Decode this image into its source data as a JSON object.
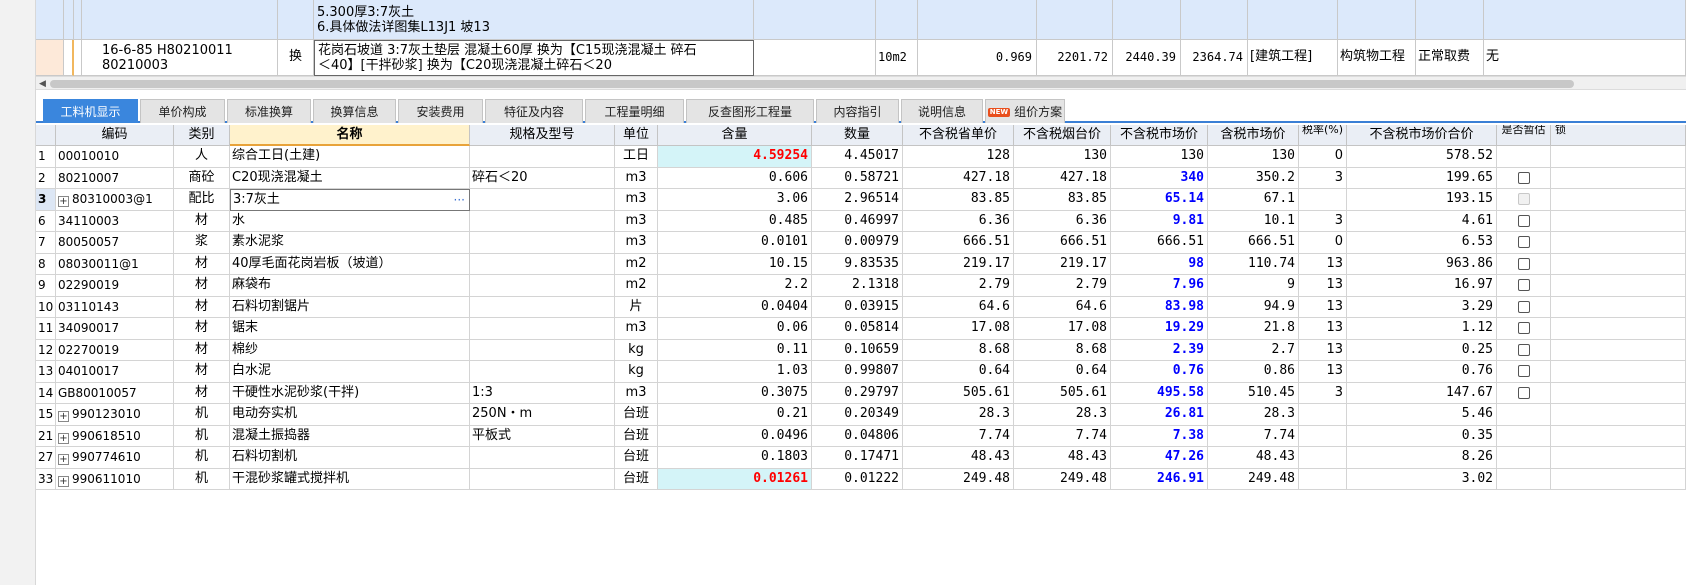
{
  "upper": {
    "row1": {
      "desc_lines": [
        "5.300厚3:7灰土",
        "6.具体做法详图集L13J1 坡13"
      ]
    },
    "row2": {
      "code_line1": "16-6-85 H80210011",
      "code_line2": "80210003",
      "type": "换",
      "desc_line1": "花岗石坡道 3:7灰土垫层 混凝土60厚  换为【C15现浇混凝土 碎石",
      "desc_line2": "＜40】[干拌砂浆]  换为【C20现浇混凝土碎石＜20",
      "unit": "10m2",
      "qty": "0.969",
      "price1": "2201.72",
      "price2": "2440.39",
      "price3": "2364.74",
      "category": "[建筑工程]",
      "project": "构筑物工程",
      "fee": "正常取费",
      "flag": "无"
    }
  },
  "tabs": [
    {
      "label": "工料机显示",
      "active": true
    },
    {
      "label": "单价构成"
    },
    {
      "label": "标准换算"
    },
    {
      "label": "换算信息"
    },
    {
      "label": "安装费用"
    },
    {
      "label": "特征及内容"
    },
    {
      "label": "工程量明细"
    },
    {
      "label": "反查图形工程量"
    },
    {
      "label": "内容指引"
    },
    {
      "label": "说明信息"
    },
    {
      "label": "组价方案",
      "badge": "NEW"
    }
  ],
  "columns": [
    "",
    "编码",
    "类别",
    "名称",
    "规格及型号",
    "单位",
    "含量",
    "数量",
    "不含税省单价",
    "不含税烟台价",
    "不含税市场价",
    "含税市场价",
    "税率(%)",
    "不含税市场价合价",
    "是否暂估",
    "锁"
  ],
  "rows": [
    {
      "n": "1",
      "code": "00010010",
      "type": "人",
      "name": "综合工日(土建)",
      "spec": "",
      "unit": "工日",
      "content": "4.59254",
      "qty": "4.45017",
      "p1": "128",
      "p2": "130",
      "p3": "130",
      "p4": "130",
      "tax": "0",
      "total": "578.52",
      "chk": false,
      "content_style": "red",
      "p3_style": "normal"
    },
    {
      "n": "2",
      "code": "80210007",
      "type": "商砼",
      "name": "C20现浇混凝土",
      "spec": "碎石＜20",
      "unit": "m3",
      "content": "0.606",
      "qty": "0.58721",
      "p1": "427.18",
      "p2": "427.18",
      "p3": "340",
      "p4": "350.2",
      "tax": "3",
      "total": "199.65",
      "chk": true,
      "p3_style": "blue"
    },
    {
      "n": "3",
      "code": "80310003@1",
      "type": "配比",
      "name": "3:7灰土",
      "spec": "",
      "unit": "m3",
      "content": "3.06",
      "qty": "2.96514",
      "p1": "83.85",
      "p2": "83.85",
      "p3": "65.14",
      "p4": "67.1",
      "tax": "",
      "total": "193.15",
      "chk": "disabled",
      "p3_style": "blue",
      "expand": true,
      "selected": true
    },
    {
      "n": "6",
      "code": "34110003",
      "type": "材",
      "name": "水",
      "spec": "",
      "unit": "m3",
      "content": "0.485",
      "qty": "0.46997",
      "p1": "6.36",
      "p2": "6.36",
      "p3": "9.81",
      "p4": "10.1",
      "tax": "3",
      "total": "4.61",
      "chk": true,
      "p3_style": "blue"
    },
    {
      "n": "7",
      "code": "80050057",
      "type": "浆",
      "name": "素水泥浆",
      "spec": "",
      "unit": "m3",
      "content": "0.0101",
      "qty": "0.00979",
      "p1": "666.51",
      "p2": "666.51",
      "p3": "666.51",
      "p4": "666.51",
      "tax": "0",
      "total": "6.53",
      "chk": true,
      "p3_style": "normal"
    },
    {
      "n": "8",
      "code": "08030011@1",
      "type": "材",
      "name": "40厚毛面花岗岩板（坡道）",
      "spec": "",
      "unit": "m2",
      "content": "10.15",
      "qty": "9.83535",
      "p1": "219.17",
      "p2": "219.17",
      "p3": "98",
      "p4": "110.74",
      "tax": "13",
      "total": "963.86",
      "chk": true,
      "p3_style": "blue"
    },
    {
      "n": "9",
      "code": "02290019",
      "type": "材",
      "name": "麻袋布",
      "spec": "",
      "unit": "m2",
      "content": "2.2",
      "qty": "2.1318",
      "p1": "2.79",
      "p2": "2.79",
      "p3": "7.96",
      "p4": "9",
      "tax": "13",
      "total": "16.97",
      "chk": true,
      "p3_style": "blue"
    },
    {
      "n": "10",
      "code": "03110143",
      "type": "材",
      "name": "石料切割锯片",
      "spec": "",
      "unit": "片",
      "content": "0.0404",
      "qty": "0.03915",
      "p1": "64.6",
      "p2": "64.6",
      "p3": "83.98",
      "p4": "94.9",
      "tax": "13",
      "total": "3.29",
      "chk": true,
      "p3_style": "blue"
    },
    {
      "n": "11",
      "code": "34090017",
      "type": "材",
      "name": "锯末",
      "spec": "",
      "unit": "m3",
      "content": "0.06",
      "qty": "0.05814",
      "p1": "17.08",
      "p2": "17.08",
      "p3": "19.29",
      "p4": "21.8",
      "tax": "13",
      "total": "1.12",
      "chk": true,
      "p3_style": "blue"
    },
    {
      "n": "12",
      "code": "02270019",
      "type": "材",
      "name": "棉纱",
      "spec": "",
      "unit": "kg",
      "content": "0.11",
      "qty": "0.10659",
      "p1": "8.68",
      "p2": "8.68",
      "p3": "2.39",
      "p4": "2.7",
      "tax": "13",
      "total": "0.25",
      "chk": true,
      "p3_style": "blue"
    },
    {
      "n": "13",
      "code": "04010017",
      "type": "材",
      "name": "白水泥",
      "spec": "",
      "unit": "kg",
      "content": "1.03",
      "qty": "0.99807",
      "p1": "0.64",
      "p2": "0.64",
      "p3": "0.76",
      "p4": "0.86",
      "tax": "13",
      "total": "0.76",
      "chk": true,
      "p3_style": "blue"
    },
    {
      "n": "14",
      "code": "GB80010057",
      "type": "材",
      "name": "干硬性水泥砂浆(干拌)",
      "spec": "1:3",
      "unit": "m3",
      "content": "0.3075",
      "qty": "0.29797",
      "p1": "505.61",
      "p2": "505.61",
      "p3": "495.58",
      "p4": "510.45",
      "tax": "3",
      "total": "147.67",
      "chk": true,
      "p3_style": "blue"
    },
    {
      "n": "15",
      "code": "990123010",
      "type": "机",
      "name": "电动夯实机",
      "spec": "250N・m",
      "unit": "台班",
      "content": "0.21",
      "qty": "0.20349",
      "p1": "28.3",
      "p2": "28.3",
      "p3": "26.81",
      "p4": "28.3",
      "tax": "",
      "total": "5.46",
      "chk": false,
      "p3_style": "blue",
      "expand": true
    },
    {
      "n": "21",
      "code": "990618510",
      "type": "机",
      "name": "混凝土振捣器",
      "spec": "平板式",
      "unit": "台班",
      "content": "0.0496",
      "qty": "0.04806",
      "p1": "7.74",
      "p2": "7.74",
      "p3": "7.38",
      "p4": "7.74",
      "tax": "",
      "total": "0.35",
      "chk": false,
      "p3_style": "blue",
      "expand": true
    },
    {
      "n": "27",
      "code": "990774610",
      "type": "机",
      "name": "石料切割机",
      "spec": "",
      "unit": "台班",
      "content": "0.1803",
      "qty": "0.17471",
      "p1": "48.43",
      "p2": "48.43",
      "p3": "47.26",
      "p4": "48.43",
      "tax": "",
      "total": "8.26",
      "chk": false,
      "p3_style": "blue",
      "expand": true
    },
    {
      "n": "33",
      "code": "990611010",
      "type": "机",
      "name": "干混砂浆罐式搅拌机",
      "spec": "",
      "unit": "台班",
      "content": "0.01261",
      "qty": "0.01222",
      "p1": "249.48",
      "p2": "249.48",
      "p3": "246.91",
      "p4": "249.48",
      "tax": "",
      "total": "3.02",
      "chk": false,
      "content_style": "red",
      "p3_style": "blue",
      "expand": true
    }
  ],
  "icons": {
    "expander": "plus-box-icon",
    "ellipsis": "ellipsis-icon",
    "scroll_left": "scroll-left-arrow-icon"
  }
}
